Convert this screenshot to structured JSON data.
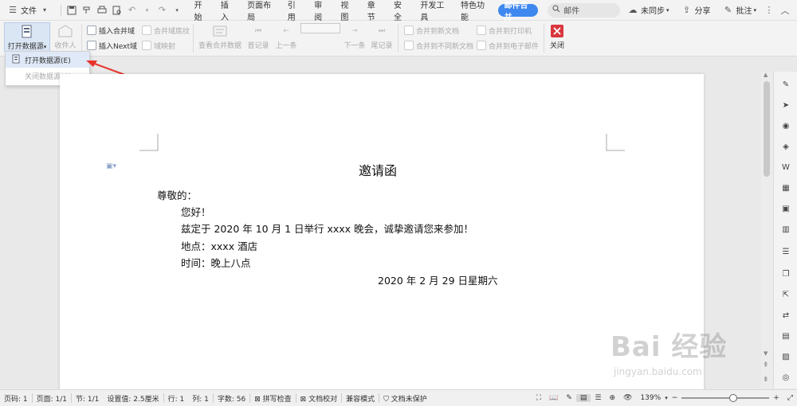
{
  "topbar": {
    "file_menu": "文件",
    "tabs": [
      "开始",
      "插入",
      "页面布局",
      "引用",
      "审阅",
      "视图",
      "章节",
      "安全",
      "开发工具",
      "特色功能",
      "邮件合并"
    ],
    "active_tab": "邮件合并",
    "search_value": "邮件",
    "sync": "未同步",
    "share": "分享",
    "comment": "批注"
  },
  "ribbon": {
    "open_source": "打开数据源",
    "recipients": "收件人",
    "insert_field": "插入合并域",
    "insert_next": "插入Next域",
    "field_shading": "合并域底纹",
    "field_map": "域映射",
    "view_merged": "查看合并数据",
    "first": "首记录",
    "prev": "上一条",
    "next": "下一条",
    "last": "尾记录",
    "merge_new_doc": "合并到新文档",
    "merge_diff_doc": "合并到不同新文档",
    "merge_printer": "合并到打印机",
    "merge_email": "合并到电子邮件",
    "close": "关闭"
  },
  "dropdown": {
    "items": [
      "打开数据源(E)",
      "关闭数据源(C)"
    ]
  },
  "document": {
    "title": "邀请函",
    "greeting": "尊敬的：",
    "hello": "您好！",
    "line1": "兹定于 2020 年 10 月 1 日举行 xxxx 晚会，诚挚邀请您来参加！",
    "place": "地点：xxxx 酒店",
    "time": "时间：晚上八点",
    "date": "2020 年 2 月 29 日星期六"
  },
  "status": {
    "page": "页码: 1",
    "pages": "页面: 1/1",
    "section": "节: 1/1",
    "setting": "设置值: 2.5厘米",
    "row": "行: 1",
    "col": "列: 1",
    "words": "字数: 56",
    "spell": "拼写检查",
    "proof": "文档校对",
    "compat": "兼容模式",
    "protect": "文档未保护",
    "zoom": "139%"
  },
  "watermark": {
    "brand": "Bai 经验",
    "url": "jingyan.baidu.com"
  },
  "colors": {
    "accent": "#3f88f0",
    "arrow": "#e8332a",
    "close_red": "#d9363e"
  }
}
